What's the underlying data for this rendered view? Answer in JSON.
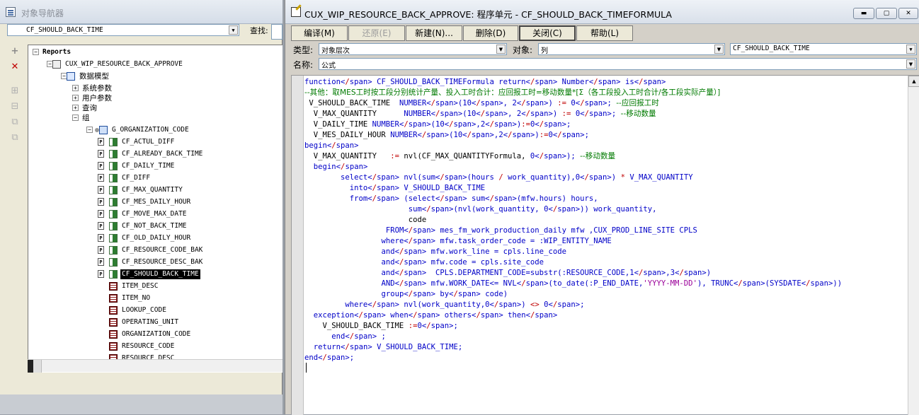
{
  "navigator": {
    "title": "对象导航器",
    "selector_value": "CF_SHOULD_BACK_TIME",
    "find_label": "查找:",
    "tree": [
      {
        "label": "Reports",
        "type": "root"
      },
      {
        "label": "CUX_WIP_RESOURCE_BACK_APPROVE",
        "type": "report"
      },
      {
        "label": "数据模型",
        "type": "model"
      },
      {
        "label": "系统参数",
        "type": "group"
      },
      {
        "label": "用户参数",
        "type": "group"
      },
      {
        "label": "查询",
        "type": "group"
      },
      {
        "label": "组",
        "type": "group"
      },
      {
        "label": "G_ORGANIZATION_CODE",
        "type": "grp"
      },
      {
        "label": "CF_ACTUL_DIFF",
        "type": "formula"
      },
      {
        "label": "CF_ALREADY_BACK_TIME",
        "type": "formula"
      },
      {
        "label": "CF_DAILY_TIME",
        "type": "formula"
      },
      {
        "label": "CF_DIFF",
        "type": "formula"
      },
      {
        "label": "CF_MAX_QUANTITY",
        "type": "formula"
      },
      {
        "label": "CF_MES_DAILY_HOUR",
        "type": "formula"
      },
      {
        "label": "CF_MOVE_MAX_DATE",
        "type": "formula"
      },
      {
        "label": "CF_NOT_BACK_TIME",
        "type": "formula"
      },
      {
        "label": "CF_OLD_DAILY_HOUR",
        "type": "formula"
      },
      {
        "label": "CF_RESOURCE_CODE_BAK",
        "type": "formula"
      },
      {
        "label": "CF_RESOURCE_DESC_BAK",
        "type": "formula"
      },
      {
        "label": "CF_SHOULD_BACK_TIME",
        "type": "formula",
        "selected": true
      },
      {
        "label": "ITEM_DESC",
        "type": "column"
      },
      {
        "label": "ITEM_NO",
        "type": "column"
      },
      {
        "label": "LOOKUP_CODE",
        "type": "column"
      },
      {
        "label": "OPERATING_UNIT",
        "type": "column"
      },
      {
        "label": "ORGANIZATION_CODE",
        "type": "column"
      },
      {
        "label": "RESOURCE_CODE",
        "type": "column"
      },
      {
        "label": "RESOURCE_DESC",
        "type": "column"
      }
    ]
  },
  "editor": {
    "title": "CUX_WIP_RESOURCE_BACK_APPROVE: 程序单元 - CF_SHOULD_BACK_TIMEFORMULA",
    "buttons": {
      "compile": "编译(M)",
      "revert": "还原(E)",
      "new": "新建(N)...",
      "delete": "删除(D)",
      "close": "关闭(C)",
      "help": "帮助(L)"
    },
    "type_label": "类型:",
    "type_value": "对象层次",
    "object_label": "对象:",
    "object_value": "列",
    "object_name_value": "CF_SHOULD_BACK_TIME",
    "name_label": "名称:",
    "name_value": "公式",
    "code_lines": [
      "function CF_SHOULD_BACK_TIMEFormula return Number is",
      "--其他：取MES工时按工段分别统计产量、投入工时合计：应回报工时=移动数量*[Σ（各工段投入工时合计/各工段实际产量）]",
      " V_SHOULD_BACK_TIME  NUMBER(10, 2) := 0; --应回报工时",
      "  V_MAX_QUANTITY      NUMBER(10, 2) := 0; --移动数量",
      "  V_DAILY_TIME NUMBER(10,2):=0;",
      "  V_MES_DAILY_HOUR NUMBER(10,2):=0;",
      "begin",
      "  V_MAX_QUANTITY   := nvl(CF_MAX_QUANTITYFormula, 0); --移动数量",
      "  begin",
      "        select nvl(sum(hours / work_quantity),0) * V_MAX_QUANTITY",
      "          into V_SHOULD_BACK_TIME",
      "          from (select sum(mfw.hours) hours,",
      "                       sum(nvl(work_quantity, 0)) work_quantity,",
      "                       code",
      "                  FROM mes_fm_work_production_daily mfw ,CUX_PROD_LINE_SITE CPLS",
      "                 where mfw.task_order_code = :WIP_ENTITY_NAME",
      "                 and mfw.work_line = cpls.line_code",
      "                 and mfw.code = cpls.site_code",
      "                 and  CPLS.DEPARTMENT_CODE=substr(:RESOURCE_CODE,1,3)",
      "                 AND mfw.WORK_DATE<= NVL(to_date(:P_END_DATE,'YYYY-MM-DD'), TRUNC(SYSDATE))",
      "                 group by code)",
      "         where nvl(work_quantity,0) <> 0;",
      "  exception when others then",
      "    V_SHOULD_BACK_TIME :=0;",
      "      end ;",
      "  return V_SHOULD_BACK_TIME;",
      "end;"
    ]
  }
}
